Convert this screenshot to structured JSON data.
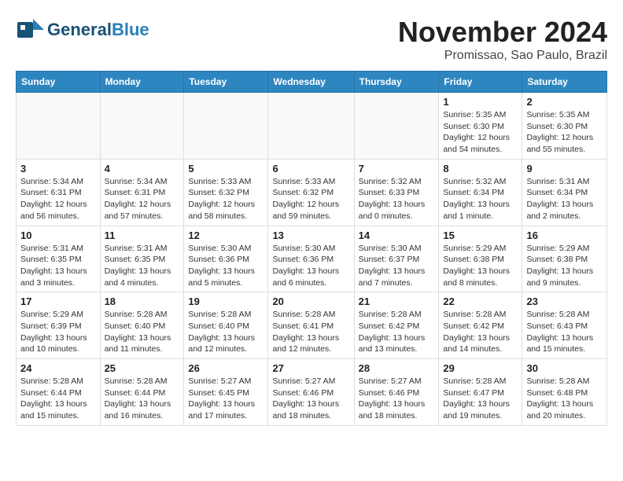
{
  "header": {
    "logo_general": "General",
    "logo_blue": "Blue",
    "month_title": "November 2024",
    "location": "Promissao, Sao Paulo, Brazil"
  },
  "calendar": {
    "days_of_week": [
      "Sunday",
      "Monday",
      "Tuesday",
      "Wednesday",
      "Thursday",
      "Friday",
      "Saturday"
    ],
    "weeks": [
      [
        {
          "day": "",
          "info": ""
        },
        {
          "day": "",
          "info": ""
        },
        {
          "day": "",
          "info": ""
        },
        {
          "day": "",
          "info": ""
        },
        {
          "day": "",
          "info": ""
        },
        {
          "day": "1",
          "info": "Sunrise: 5:35 AM\nSunset: 6:30 PM\nDaylight: 12 hours and 54 minutes."
        },
        {
          "day": "2",
          "info": "Sunrise: 5:35 AM\nSunset: 6:30 PM\nDaylight: 12 hours and 55 minutes."
        }
      ],
      [
        {
          "day": "3",
          "info": "Sunrise: 5:34 AM\nSunset: 6:31 PM\nDaylight: 12 hours and 56 minutes."
        },
        {
          "day": "4",
          "info": "Sunrise: 5:34 AM\nSunset: 6:31 PM\nDaylight: 12 hours and 57 minutes."
        },
        {
          "day": "5",
          "info": "Sunrise: 5:33 AM\nSunset: 6:32 PM\nDaylight: 12 hours and 58 minutes."
        },
        {
          "day": "6",
          "info": "Sunrise: 5:33 AM\nSunset: 6:32 PM\nDaylight: 12 hours and 59 minutes."
        },
        {
          "day": "7",
          "info": "Sunrise: 5:32 AM\nSunset: 6:33 PM\nDaylight: 13 hours and 0 minutes."
        },
        {
          "day": "8",
          "info": "Sunrise: 5:32 AM\nSunset: 6:34 PM\nDaylight: 13 hours and 1 minute."
        },
        {
          "day": "9",
          "info": "Sunrise: 5:31 AM\nSunset: 6:34 PM\nDaylight: 13 hours and 2 minutes."
        }
      ],
      [
        {
          "day": "10",
          "info": "Sunrise: 5:31 AM\nSunset: 6:35 PM\nDaylight: 13 hours and 3 minutes."
        },
        {
          "day": "11",
          "info": "Sunrise: 5:31 AM\nSunset: 6:35 PM\nDaylight: 13 hours and 4 minutes."
        },
        {
          "day": "12",
          "info": "Sunrise: 5:30 AM\nSunset: 6:36 PM\nDaylight: 13 hours and 5 minutes."
        },
        {
          "day": "13",
          "info": "Sunrise: 5:30 AM\nSunset: 6:36 PM\nDaylight: 13 hours and 6 minutes."
        },
        {
          "day": "14",
          "info": "Sunrise: 5:30 AM\nSunset: 6:37 PM\nDaylight: 13 hours and 7 minutes."
        },
        {
          "day": "15",
          "info": "Sunrise: 5:29 AM\nSunset: 6:38 PM\nDaylight: 13 hours and 8 minutes."
        },
        {
          "day": "16",
          "info": "Sunrise: 5:29 AM\nSunset: 6:38 PM\nDaylight: 13 hours and 9 minutes."
        }
      ],
      [
        {
          "day": "17",
          "info": "Sunrise: 5:29 AM\nSunset: 6:39 PM\nDaylight: 13 hours and 10 minutes."
        },
        {
          "day": "18",
          "info": "Sunrise: 5:28 AM\nSunset: 6:40 PM\nDaylight: 13 hours and 11 minutes."
        },
        {
          "day": "19",
          "info": "Sunrise: 5:28 AM\nSunset: 6:40 PM\nDaylight: 13 hours and 12 minutes."
        },
        {
          "day": "20",
          "info": "Sunrise: 5:28 AM\nSunset: 6:41 PM\nDaylight: 13 hours and 12 minutes."
        },
        {
          "day": "21",
          "info": "Sunrise: 5:28 AM\nSunset: 6:42 PM\nDaylight: 13 hours and 13 minutes."
        },
        {
          "day": "22",
          "info": "Sunrise: 5:28 AM\nSunset: 6:42 PM\nDaylight: 13 hours and 14 minutes."
        },
        {
          "day": "23",
          "info": "Sunrise: 5:28 AM\nSunset: 6:43 PM\nDaylight: 13 hours and 15 minutes."
        }
      ],
      [
        {
          "day": "24",
          "info": "Sunrise: 5:28 AM\nSunset: 6:44 PM\nDaylight: 13 hours and 15 minutes."
        },
        {
          "day": "25",
          "info": "Sunrise: 5:28 AM\nSunset: 6:44 PM\nDaylight: 13 hours and 16 minutes."
        },
        {
          "day": "26",
          "info": "Sunrise: 5:27 AM\nSunset: 6:45 PM\nDaylight: 13 hours and 17 minutes."
        },
        {
          "day": "27",
          "info": "Sunrise: 5:27 AM\nSunset: 6:46 PM\nDaylight: 13 hours and 18 minutes."
        },
        {
          "day": "28",
          "info": "Sunrise: 5:27 AM\nSunset: 6:46 PM\nDaylight: 13 hours and 18 minutes."
        },
        {
          "day": "29",
          "info": "Sunrise: 5:28 AM\nSunset: 6:47 PM\nDaylight: 13 hours and 19 minutes."
        },
        {
          "day": "30",
          "info": "Sunrise: 5:28 AM\nSunset: 6:48 PM\nDaylight: 13 hours and 20 minutes."
        }
      ]
    ]
  }
}
